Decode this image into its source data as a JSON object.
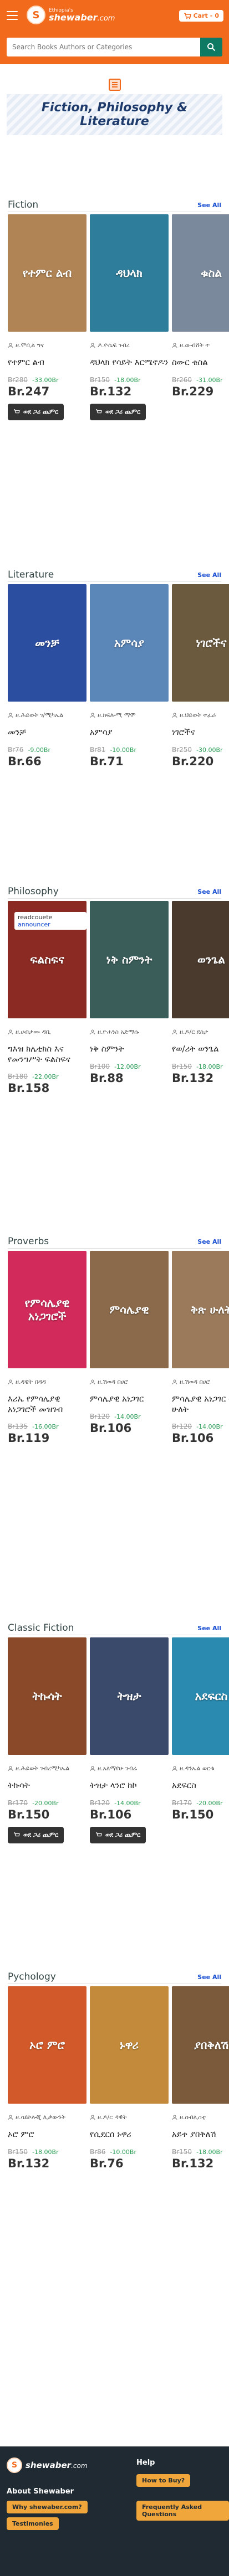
{
  "header": {
    "logo_top": "Ethiopia's",
    "logo_main": "shewaber",
    "logo_suffix": ".com",
    "cart_label": "Cart",
    "cart_count": "0",
    "search_placeholder": "Search Books Authors or Categories"
  },
  "banner": {
    "title": "Fiction, Philosophy & Literature"
  },
  "common": {
    "see_all": "See All",
    "add_to_cart": "ወደ ጋሪ ጨምር"
  },
  "sections": [
    {
      "title": "Fiction",
      "books": [
        {
          "author": "ዘ.ሞቢል ግና",
          "title": "የተምር ልብ",
          "old_price": "Br280",
          "discount": "-33.00Br",
          "price": "Br.247",
          "cover_text": "የተምር ልብ",
          "cover_color": "#b08454"
        },
        {
          "author": "ዶ.ዮሴፍ ገብረ",
          "title": "ዳህላክ የሳይት እርሜኖዶን",
          "old_price": "Br150",
          "discount": "-18.00Br",
          "price": "Br.132",
          "cover_text": "ዳህላክ",
          "cover_color": "#2e7d9a"
        },
        {
          "author": "ዘ.ውብሸት ተ",
          "title": "ስውር ቁስል",
          "old_price": "Br260",
          "discount": "-31.00Br",
          "price": "Br.229",
          "cover_text": "ቁስል",
          "cover_color": "#7a8a9c"
        }
      ]
    },
    {
      "title": "Literature",
      "books": [
        {
          "author": "ዘ.ሕይወት ገ/ሚካኤል",
          "title": "መንቻ",
          "old_price": "Br76",
          "discount": "-9.00Br",
          "price": "Br.66",
          "cover_text": "መንቻ",
          "cover_color": "#2b4ea1"
        },
        {
          "author": "ዘ.ክፍሎሚ ማሞ",
          "title": "አምሳያ",
          "old_price": "Br81",
          "discount": "-10.00Br",
          "price": "Br.71",
          "cover_text": "አምሳያ",
          "cover_color": "#5a86b8"
        },
        {
          "author": "ዘ.ህይወት ተፈራ",
          "title": "ነገሮችና",
          "old_price": "Br250",
          "discount": "-30.00Br",
          "price": "Br.220",
          "cover_text": "ነገሮችና",
          "cover_color": "#6b5a3e"
        }
      ]
    },
    {
      "title": "Philosophy",
      "books": [
        {
          "author": "ዘ.ሀብታሙ ዳቢ",
          "title": "ግእዝ ክሌቲክስ እና የመንግሥት ፍልስፍና",
          "old_price": "Br180",
          "discount": "-22.00Br",
          "price": "Br.158",
          "cover_text": "ፍልስፍና",
          "cover_color": "#8a2a22"
        },
        {
          "author": "ዘ.ዮሐንስ አድማሱ",
          "title": "ነቅ ስምንት",
          "old_price": "Br100",
          "discount": "-12.00Br",
          "price": "Br.88",
          "cover_text": "ነቅ ስምንት",
          "cover_color": "#3a5d5a"
        },
        {
          "author": "ዘ.ዶ/ር ደስታ",
          "title": "የወ/ሪት ወንጌል",
          "old_price": "Br150",
          "discount": "-18.00Br",
          "price": "Br.132",
          "cover_text": "ወንጌል",
          "cover_color": "#4a3a2e"
        }
      ]
    },
    {
      "title": "Proverbs",
      "books": [
        {
          "author": "ዘ.ዳዊት በዳዳ",
          "title": "እሪኤ የምሳሌያዊ አነጋገሮች መዝገብ",
          "old_price": "Br135",
          "discount": "-16.00Br",
          "price": "Br.119",
          "cover_text": "የምሳሌያዊ አነጋገሮች",
          "cover_color": "#d22a5a"
        },
        {
          "author": "ዘ.ሽወዳ በሀሮ",
          "title": "ምሳሌያዊ አነጋገር",
          "old_price": "Br120",
          "discount": "-14.00Br",
          "price": "Br.106",
          "cover_text": "ምሳሌያዊ",
          "cover_color": "#8a6a4a"
        },
        {
          "author": "ዘ.ሽወዳ በሀሮ",
          "title": "ምሳሌያዊ አነጋገር ቅጽ ሁለት",
          "old_price": "Br120",
          "discount": "-14.00Br",
          "price": "Br.106",
          "cover_text": "ቅጽ ሁለት",
          "cover_color": "#9a7a5a"
        }
      ]
    },
    {
      "title": "Classic Fiction",
      "books": [
        {
          "author": "ዘ.ሕይወት ገብረሚካኤል",
          "title": "ትኩሳት",
          "old_price": "Br170",
          "discount": "-20.00Br",
          "price": "Br.150",
          "cover_text": "ትኩሳት",
          "cover_color": "#8a4a2a"
        },
        {
          "author": "ዘ.አለማየሁ ገብሬ",
          "title": "ትዝታ ላንሮ ከኮ",
          "old_price": "Br120",
          "discount": "-14.00Br",
          "price": "Br.106",
          "cover_text": "ትዝታ",
          "cover_color": "#3a4a6a"
        },
        {
          "author": "ዘ.ዳንኤል ወርቁ",
          "title": "አደፍርስ",
          "old_price": "Br170",
          "discount": "-20.00Br",
          "price": "Br.150",
          "cover_text": "አደፍርስ",
          "cover_color": "#2a8ab0"
        }
      ]
    },
    {
      "title": "Pychology",
      "books": [
        {
          "author": "ዘ.ሳይኮሎጂ ሊቃውንት",
          "title": "ኦሮ ምሮ",
          "old_price": "Br150",
          "discount": "-18.00Br",
          "price": "Br.132",
          "cover_text": "ኦሮ ምሮ",
          "cover_color": "#d25a2a"
        },
        {
          "author": "ዘ.ዶ/ር ዳዊት",
          "title": "የሲደርሰ ኑዋሪ",
          "old_price": "Br86",
          "discount": "-10.00Br",
          "price": "Br.76",
          "cover_text": "ኑዋሪ",
          "cover_color": "#c28a3a"
        },
        {
          "author": "ዘ.ሰብሊስቲ",
          "title": "አይቀ ያበቅለሽ",
          "old_price": "Br150",
          "discount": "-18.00Br",
          "price": "Br.132",
          "cover_text": "ያበቅለሽ",
          "cover_color": "#7a5a3a"
        }
      ]
    }
  ],
  "announcer": {
    "prefix": "readcouete",
    "label": "announcer"
  },
  "footer": {
    "logo_main": "shewaber",
    "logo_suffix": ".com",
    "about_title": "About Shewaber",
    "help_title": "Help",
    "why_label": "Why shewaber.com?",
    "testimonies_label": "Testimonies",
    "how_to_buy_label": "How to Buy?",
    "faq_label": "Frequently Asked Questions"
  }
}
